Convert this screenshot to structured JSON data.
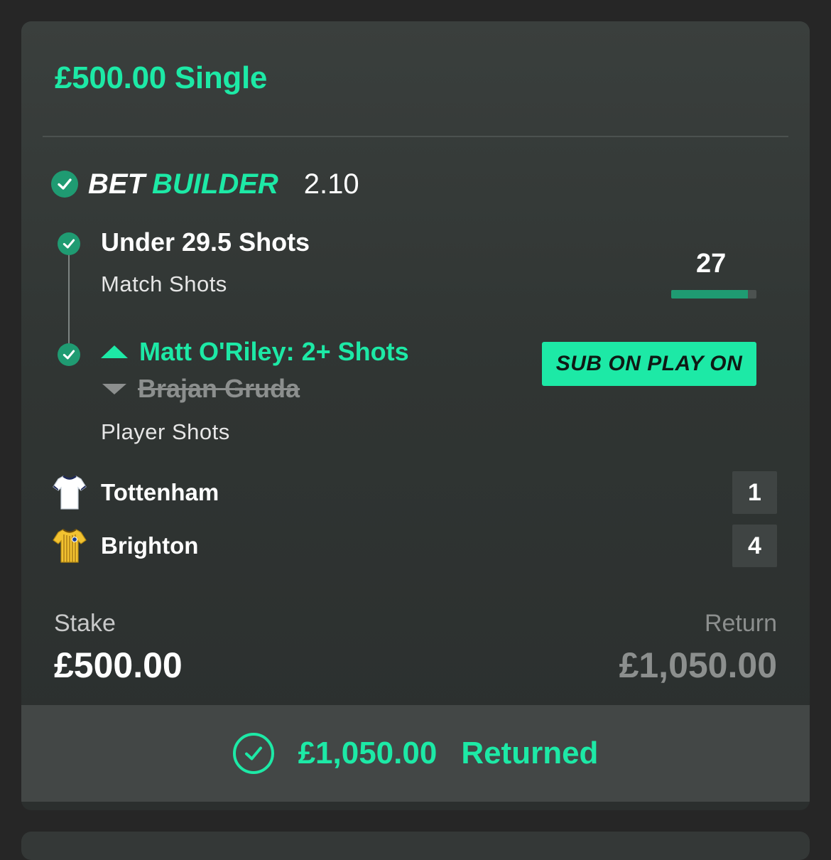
{
  "bet": {
    "title": "£500.00 Single",
    "builder_word1": "BET",
    "builder_word2": "BUILDER",
    "odds": "2.10"
  },
  "selections": [
    {
      "title": "Under 29.5 Shots",
      "market": "Match Shots",
      "progress_value": "27",
      "progress_fraction": 0.9
    },
    {
      "sub_on": "Matt O'Riley: 2+ Shots",
      "sub_off": "Brajan Gruda",
      "market": "Player Shots",
      "badge": "SUB ON PLAY ON"
    }
  ],
  "teams": [
    {
      "name": "Tottenham",
      "score": "1",
      "shirt_color": "#ffffff"
    },
    {
      "name": "Brighton",
      "score": "4",
      "shirt_color": "#f2c230"
    }
  ],
  "stake": {
    "label": "Stake",
    "value": "£500.00"
  },
  "return": {
    "label": "Return",
    "value": "£1,050.00"
  },
  "footer": {
    "amount": "£1,050.00",
    "label": "Returned"
  },
  "colors": {
    "accent": "#1de9a6",
    "check_green": "#1f9b72"
  }
}
